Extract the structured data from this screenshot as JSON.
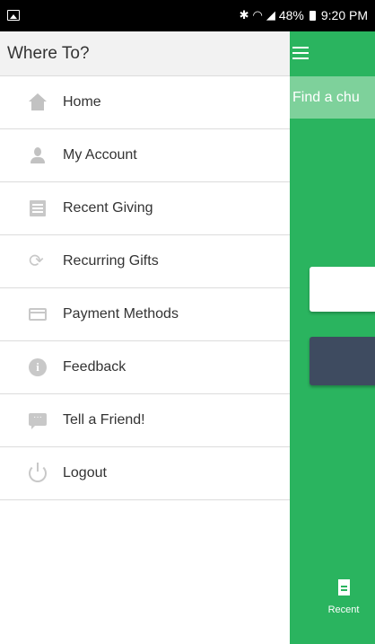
{
  "status": {
    "battery": "48%",
    "time": "9:20 PM"
  },
  "drawer": {
    "title": "Where To?",
    "items": [
      {
        "label": "Home",
        "icon": "home-icon"
      },
      {
        "label": "My Account",
        "icon": "person-icon"
      },
      {
        "label": "Recent Giving",
        "icon": "list-icon"
      },
      {
        "label": "Recurring Gifts",
        "icon": "recurring-icon"
      },
      {
        "label": "Payment Methods",
        "icon": "credit-card-icon"
      },
      {
        "label": "Feedback",
        "icon": "info-icon"
      },
      {
        "label": "Tell a Friend!",
        "icon": "chat-icon"
      },
      {
        "label": "Logout",
        "icon": "power-icon"
      }
    ]
  },
  "app": {
    "subheader": "Find a chu",
    "tabs": {
      "recent": "Recent"
    },
    "colors": {
      "primary": "#2ab45f",
      "button": "#3e4b60"
    }
  }
}
